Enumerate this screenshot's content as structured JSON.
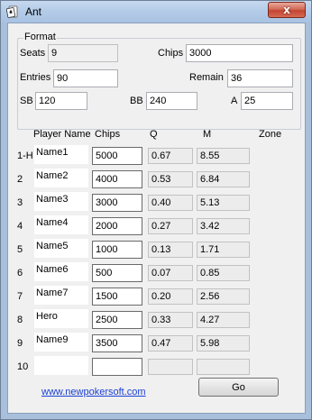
{
  "window": {
    "title": "Ant",
    "close_glyph": "x"
  },
  "format": {
    "group_label": "Format",
    "seats_label": "Seats",
    "seats_value": "9",
    "chips_label": "Chips",
    "chips_value": "3000",
    "entries_label": "Entries",
    "entries_value": "90",
    "remain_label": "Remain",
    "remain_value": "36",
    "sb_label": "SB",
    "sb_value": "120",
    "bb_label": "BB",
    "bb_value": "240",
    "a_label": "A",
    "a_value": "25"
  },
  "table": {
    "headers": {
      "player_name": "Player Name",
      "chips": "Chips",
      "q": "Q",
      "m": "M",
      "zone": "Zone"
    },
    "rows": [
      {
        "seat": "1-H",
        "name": "Name1",
        "chips": "5000",
        "q": "0.67",
        "m": "8.55"
      },
      {
        "seat": "2",
        "name": "Name2",
        "chips": "4000",
        "q": "0.53",
        "m": "6.84"
      },
      {
        "seat": "3",
        "name": "Name3",
        "chips": "3000",
        "q": "0.40",
        "m": "5.13"
      },
      {
        "seat": "4",
        "name": "Name4",
        "chips": "2000",
        "q": "0.27",
        "m": "3.42"
      },
      {
        "seat": "5",
        "name": "Name5",
        "chips": "1000",
        "q": "0.13",
        "m": "1.71"
      },
      {
        "seat": "6",
        "name": "Name6",
        "chips": "500",
        "q": "0.07",
        "m": "0.85"
      },
      {
        "seat": "7",
        "name": "Name7",
        "chips": "1500",
        "q": "0.20",
        "m": "2.56"
      },
      {
        "seat": "8",
        "name": "Hero",
        "chips": "2500",
        "q": "0.33",
        "m": "4.27"
      },
      {
        "seat": "9",
        "name": "Name9",
        "chips": "3500",
        "q": "0.47",
        "m": "5.98"
      },
      {
        "seat": "10",
        "name": "",
        "chips": "",
        "q": "",
        "m": ""
      }
    ]
  },
  "footer": {
    "link_text": "www.newpokersoft.com",
    "go_label": "Go"
  },
  "icons": {
    "app": "spade-card-icon",
    "close": "close-icon"
  },
  "colors": {
    "link": "#1a3fd4",
    "close_button": "#c24532",
    "titlebar": "#b3cbe7"
  }
}
